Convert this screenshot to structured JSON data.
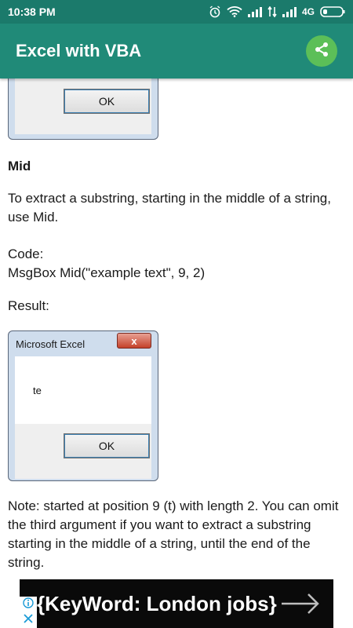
{
  "status_bar": {
    "time": "10:38 PM",
    "network": "4G"
  },
  "app_bar": {
    "title": "Excel with VBA",
    "share_icon": "share-icon",
    "accent": "#208a78"
  },
  "content": {
    "top_dialog": {
      "ok_label": "OK"
    },
    "section_heading": "Mid",
    "description": "To extract a substring, starting in the middle of a string, use Mid.",
    "code_label": "Code:",
    "code_text": "MsgBox Mid(\"example text\", 9, 2)",
    "result_label": "Result:",
    "result_dialog": {
      "title": "Microsoft Excel",
      "close_label": "x",
      "message": "te",
      "ok_label": "OK"
    },
    "note": "Note: started at position 9 (t) with length 2. You can omit the third argument if you want to extract a substring starting in the middle of a string, until the end of the string."
  },
  "ad": {
    "text": "{KeyWord: London jobs}"
  }
}
